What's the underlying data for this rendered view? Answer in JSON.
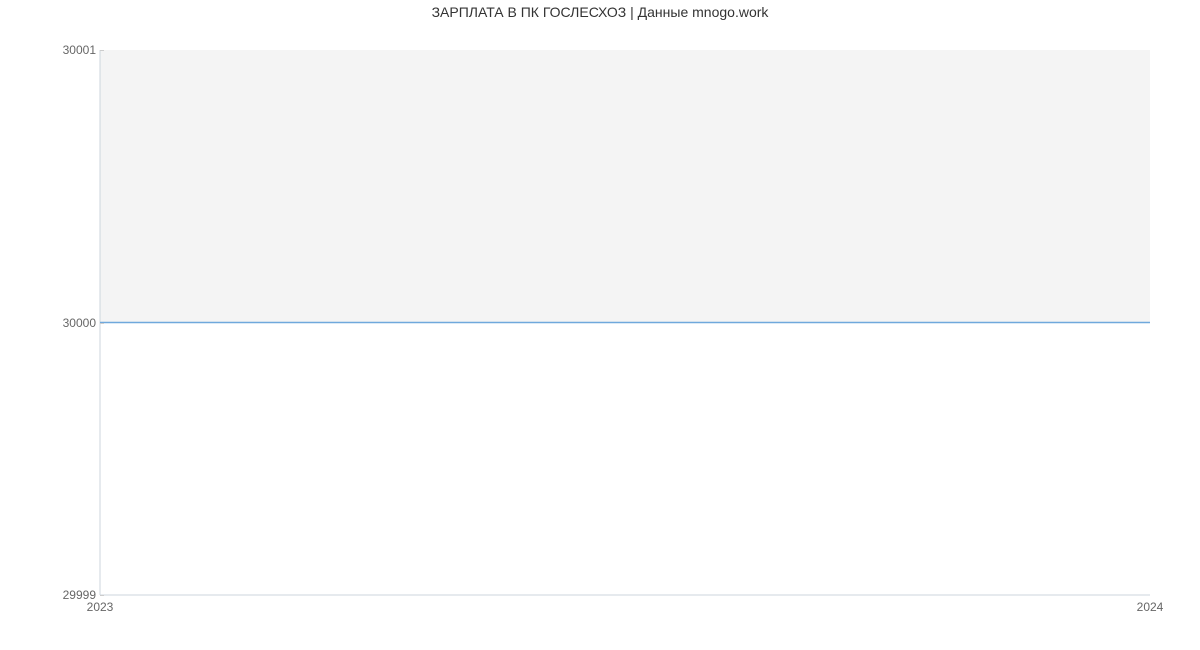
{
  "chart_data": {
    "type": "line",
    "title": "ЗАРПЛАТА В ПК ГОСЛЕСХОЗ | Данные mnogo.work",
    "xlabel": "",
    "ylabel": "",
    "x": [
      2023,
      2024
    ],
    "values": [
      30000,
      30000
    ],
    "xticks": [
      2023,
      2024
    ],
    "yticks": [
      29999,
      30000,
      30001
    ],
    "ylim": [
      29999,
      30001
    ],
    "xlim": [
      2023,
      2024
    ],
    "line_color": "#6fa8dc",
    "plot_bg_top": "#f4f4f4",
    "plot_bg_bottom": "#ffffff"
  }
}
